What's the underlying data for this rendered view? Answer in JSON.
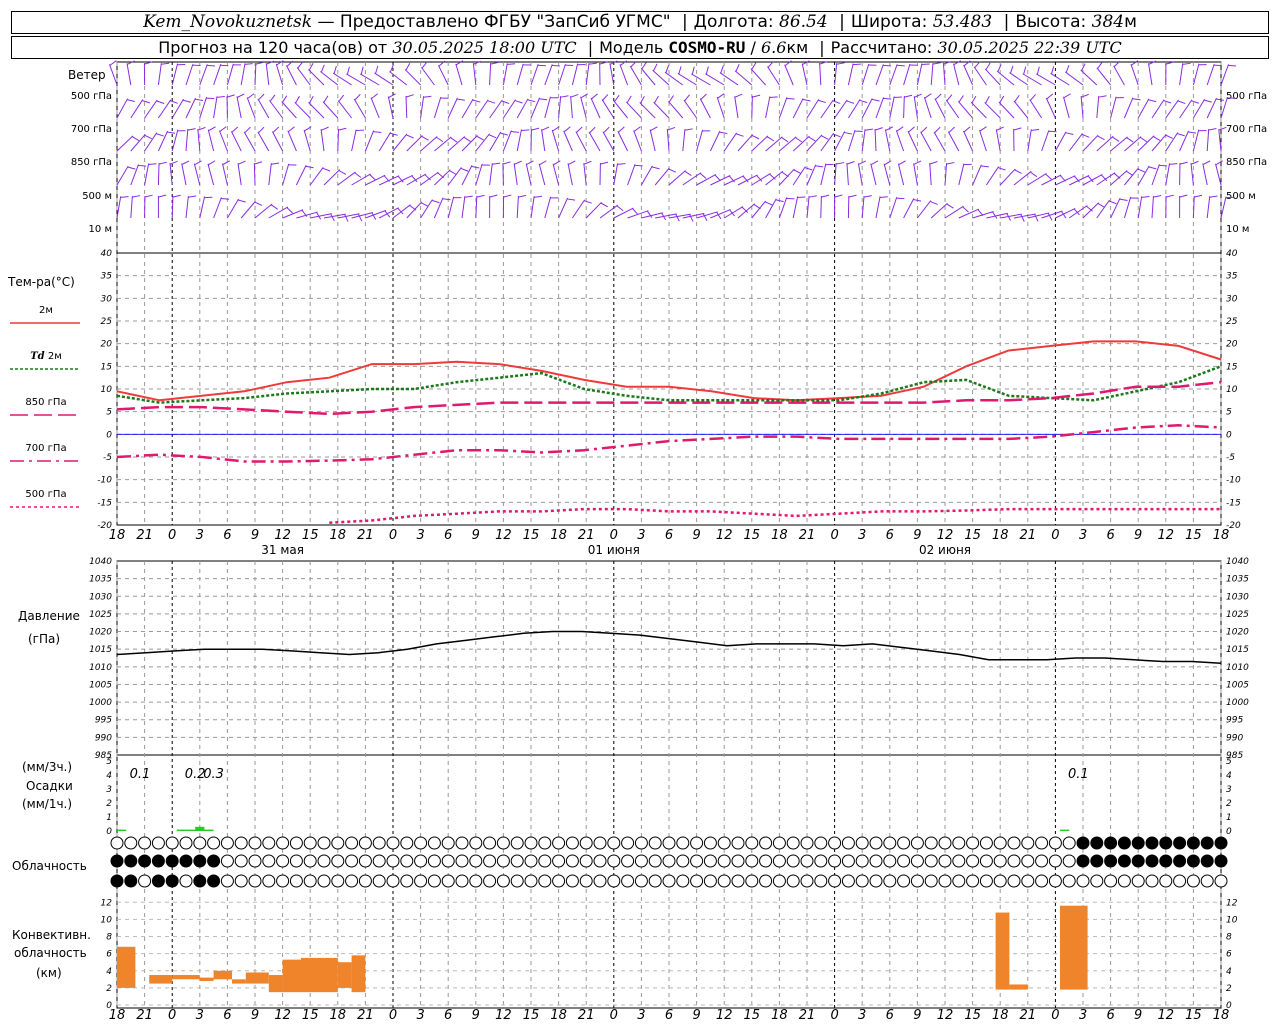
{
  "header": {
    "station": "Kem_Novokuznetsk",
    "provider": "— Предоставлено ФГБУ \"ЗапСиб УГМС\"",
    "lon_label": "Долгота:",
    "lon": "86.54",
    "lat_label": "Широта:",
    "lat": "53.483",
    "alt_label": "Высота:",
    "alt": "384",
    "alt_unit": "м",
    "forecast_label": "Прогноз на 120 часа(ов) от",
    "start": "30.05.2025 18:00 UTC",
    "model_label": "Модель",
    "model": "COSMO-RU",
    "res": "6.6",
    "res_unit": "км",
    "calc_label": "Рассчитано:",
    "calc": "30.05.2025 22:39 UTC"
  },
  "labels": {
    "wind": "Ветер",
    "temp": "Тем-ра(°C)",
    "t2m": "2м",
    "td": "Td",
    "td2m": "2м",
    "p850": "850 гПа",
    "p700": "700 гПа",
    "p500": "500 гПа",
    "pressure": "Давление",
    "pressure_unit": "(гПа)",
    "precip_unit3": "(мм/3ч.)",
    "precip": "Осадки",
    "precip_unit1": "(мм/1ч.)",
    "cloud": "Облачность",
    "conv1": "Конвективн.",
    "conv2": "облачность",
    "conv_unit": "(км)"
  },
  "colors": {
    "wind": "#8a2be2",
    "t2m": "#ee3a3a",
    "td": "#1a7a1a",
    "t850": "#e0186e",
    "precip": "#22cc22",
    "conv": "#f0842a",
    "zero": "#0000ff"
  },
  "chart_data": [
    {
      "type": "line",
      "panel": "wind",
      "levels": [
        "500 гПа",
        "700 гПа",
        "850 гПа",
        "500 м",
        "10 м"
      ]
    },
    {
      "type": "line",
      "panel": "temperature",
      "ylim": [
        -20,
        40
      ],
      "yticks": [
        40,
        35,
        30,
        25,
        20,
        15,
        10,
        5,
        0,
        -5,
        -10,
        -15,
        -20
      ],
      "xticks": [
        "18",
        "21",
        "0",
        "3",
        "6",
        "9",
        "12",
        "15",
        "18",
        "21",
        "0",
        "3",
        "6",
        "9",
        "12",
        "15",
        "18",
        "21",
        "0",
        "3",
        "6",
        "9",
        "12",
        "15",
        "18",
        "21",
        "0"
      ],
      "day_labels": [
        "31 мая",
        "01 июня",
        "02 июня"
      ],
      "x_hours": [
        0,
        3,
        6,
        9,
        12,
        15,
        18,
        21,
        24,
        27,
        30,
        33,
        36,
        39,
        42,
        45,
        48,
        51,
        54,
        57,
        60,
        63,
        66,
        69,
        72,
        75,
        78
      ],
      "series": [
        {
          "name": "2м",
          "values": [
            9.5,
            7.5,
            8.5,
            9.5,
            11.5,
            12.5,
            15.5,
            15.5,
            16,
            15.5,
            14,
            12,
            10.5,
            10.5,
            9.5,
            8,
            7.5,
            8,
            8.5,
            10.5,
            15,
            18.5,
            19.5,
            20.5,
            20.5,
            19.5,
            16.5
          ]
        },
        {
          "name": "Td 2м",
          "values": [
            8.5,
            7,
            7.5,
            8,
            9,
            9.5,
            10,
            10,
            11.5,
            12.5,
            13.5,
            10,
            8.5,
            7.5,
            7.5,
            7.5,
            7.5,
            7.5,
            9,
            11.5,
            12,
            8.5,
            8,
            7.5,
            9.5,
            11.5,
            15
          ]
        },
        {
          "name": "850 гПа",
          "values": [
            5.5,
            6,
            6,
            5.5,
            5,
            4.5,
            5,
            6,
            6.5,
            7,
            7,
            7,
            7,
            7,
            7,
            7,
            7,
            7,
            7,
            7,
            7.5,
            7.5,
            8,
            9,
            10.5,
            10.5,
            11.5
          ]
        },
        {
          "name": "700 гПа",
          "values": [
            -5,
            -4.5,
            -5,
            -6,
            -6,
            -5.8,
            -5.5,
            -4.5,
            -3.5,
            -3.5,
            -4,
            -3.5,
            -2.5,
            -1.5,
            -1,
            -0.5,
            -0.5,
            -1,
            -1,
            -1,
            -1,
            -1,
            -0.5,
            0.5,
            1.5,
            2,
            1.5
          ]
        },
        {
          "name": "500 гПа",
          "values": [
            null,
            null,
            null,
            null,
            null,
            -19.5,
            -19,
            -18,
            -17.5,
            -17,
            -17,
            -16.5,
            -16.5,
            -17,
            -17,
            -17.5,
            -18,
            -17.5,
            -17,
            -17,
            -16.8,
            -16.5,
            -16.5,
            -16.5,
            -16.5,
            -16.5,
            -16.5
          ]
        }
      ]
    },
    {
      "type": "line",
      "panel": "pressure",
      "ylim": [
        985,
        1040
      ],
      "yticks": [
        1040,
        1035,
        1030,
        1025,
        1020,
        1015,
        1010,
        1005,
        1000,
        995,
        990,
        985
      ],
      "series": [
        {
          "name": "Давление",
          "values": [
            1013.5,
            1014,
            1014.5,
            1015,
            1015,
            1015,
            1014.5,
            1014,
            1013.5,
            1014,
            1015,
            1016.5,
            1017.5,
            1018.5,
            1019.5,
            1020,
            1020,
            1019.5,
            1019,
            1018,
            1017,
            1016,
            1016.5,
            1016.5,
            1016.5,
            1016,
            1016.5,
            1015.5,
            1014.5,
            1013.5,
            1012,
            1012,
            1012,
            1012.5,
            1012.5,
            1012,
            1011.5,
            1011.5,
            1011
          ]
        }
      ]
    },
    {
      "type": "bar",
      "panel": "precipitation",
      "ylim": [
        0,
        5
      ],
      "annotations": [
        "0.1",
        "0.2",
        "0.3",
        "0.1"
      ]
    },
    {
      "type": "bar",
      "panel": "convective_cloud",
      "ylim": [
        0,
        12
      ],
      "yticks": [
        12,
        10,
        8,
        6,
        4,
        2,
        0
      ]
    }
  ]
}
